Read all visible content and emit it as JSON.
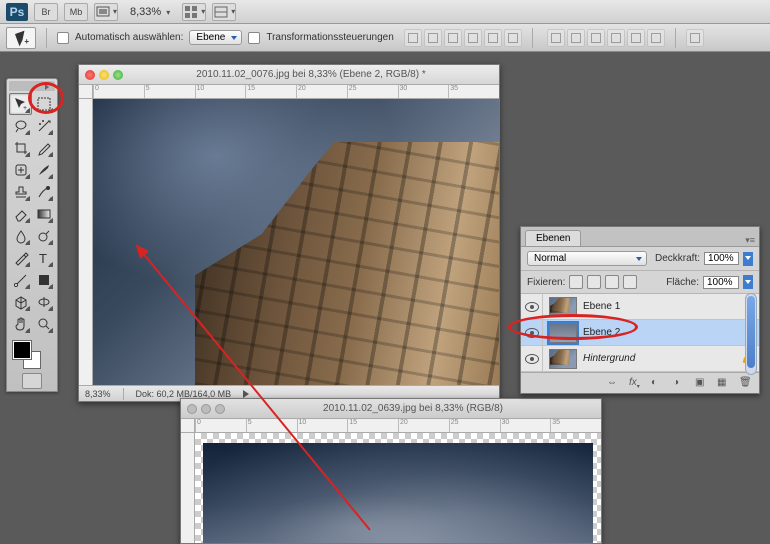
{
  "menubar": {
    "br": "Br",
    "mb": "Mb",
    "zoom": "8,33%"
  },
  "options": {
    "auto_select_label": "Automatisch auswählen:",
    "auto_select_target": "Ebene",
    "show_transform_label": "Transformationssteuerungen"
  },
  "toolbox": {
    "tools": [
      [
        "move",
        "marquee"
      ],
      [
        "lasso",
        "wand"
      ],
      [
        "crop",
        "eyedropper"
      ],
      [
        "heal",
        "brush"
      ],
      [
        "stamp",
        "history"
      ],
      [
        "eraser",
        "gradient"
      ],
      [
        "blur",
        "dodge"
      ],
      [
        "pen",
        "type"
      ],
      [
        "path",
        "shape"
      ],
      [
        "3d",
        "3dcam"
      ],
      [
        "hand",
        "zoom"
      ]
    ]
  },
  "doc1": {
    "title": "2010.11.02_0076.jpg bei 8,33% (Ebene 2, RGB/8) *",
    "status_zoom": "8,33%",
    "status_doc": "Dok: 60,2 MB/164,0 MB",
    "ruler_marks": [
      "0",
      "5",
      "10",
      "15",
      "20",
      "25",
      "30",
      "35"
    ]
  },
  "doc2": {
    "title": "2010.11.02_0639.jpg bei 8,33% (RGB/8)",
    "ruler_marks": [
      "0",
      "5",
      "10",
      "15",
      "20",
      "25",
      "30",
      "35"
    ]
  },
  "layers_panel": {
    "tab": "Ebenen",
    "blend_mode": "Normal",
    "opacity_label": "Deckkraft:",
    "opacity_value": "100%",
    "lock_label": "Fixieren:",
    "fill_label": "Fläche:",
    "fill_value": "100%",
    "layers": [
      {
        "name": "Ebene 1",
        "selected": false,
        "bg": false,
        "thumb": "building"
      },
      {
        "name": "Ebene 2",
        "selected": true,
        "bg": false,
        "thumb": "sky"
      },
      {
        "name": "Hintergrund",
        "selected": false,
        "bg": true,
        "thumb": "building"
      }
    ],
    "footer_icons": [
      "link",
      "fx",
      "mask",
      "adjust",
      "group",
      "new",
      "trash"
    ]
  }
}
